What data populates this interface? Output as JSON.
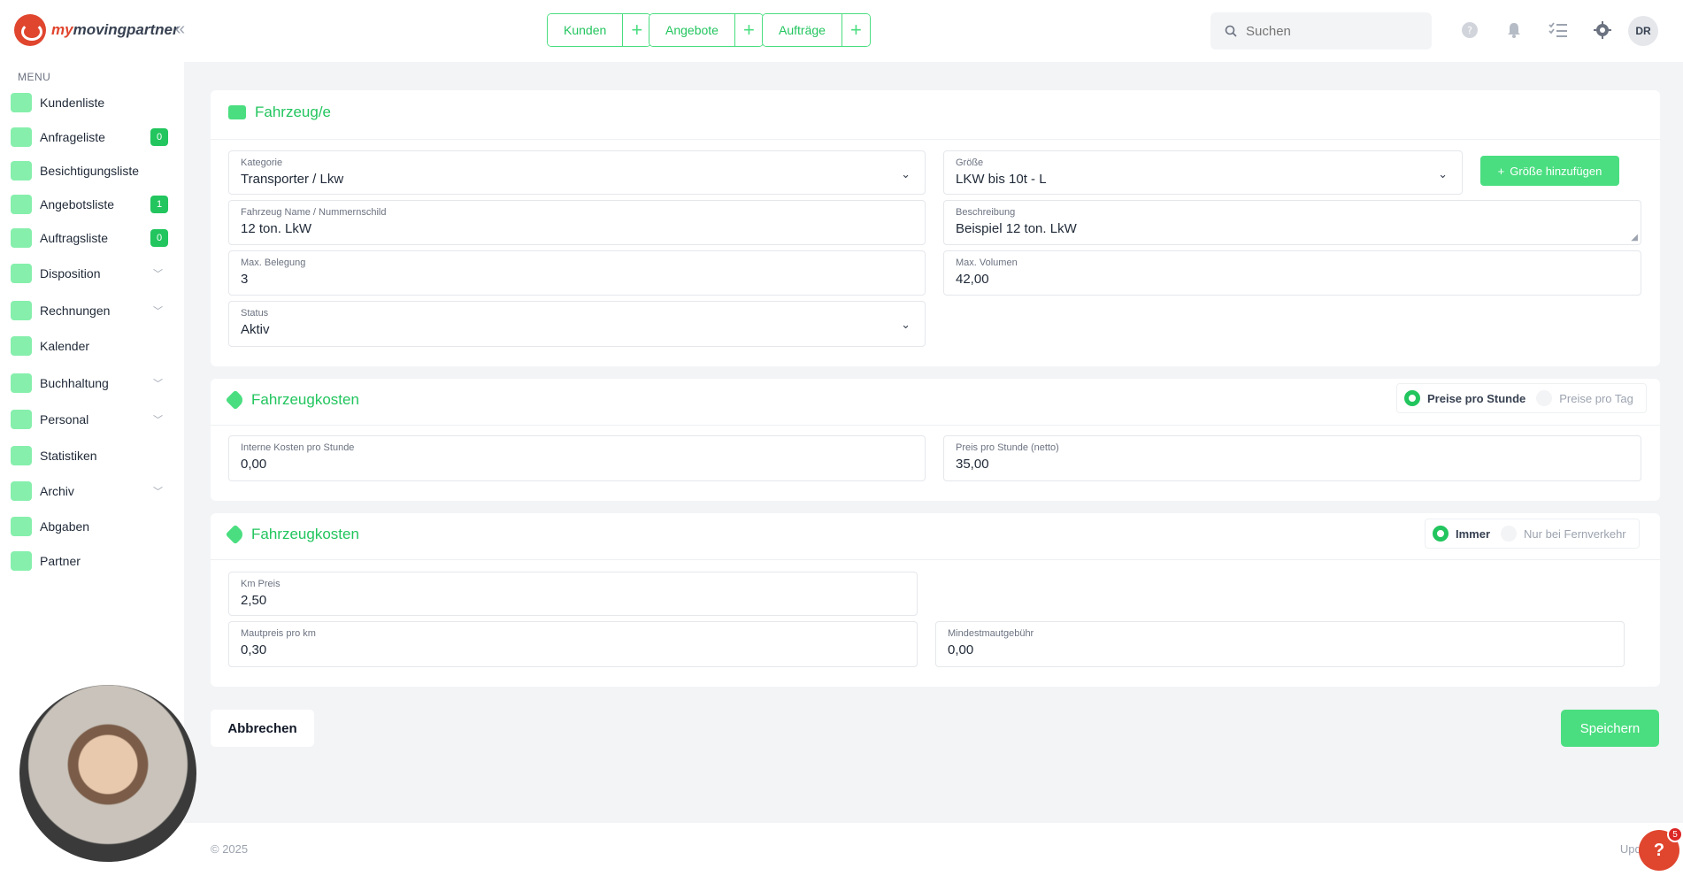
{
  "header": {
    "logo_prefix": "my",
    "logo_text": "movingpartner",
    "quick_buttons": [
      {
        "label": "Kunden"
      },
      {
        "label": "Angebote"
      },
      {
        "label": "Aufträge"
      }
    ],
    "search_placeholder": "Suchen",
    "avatar_initials": "DR"
  },
  "sidebar": {
    "menu_title": "MENU",
    "items": [
      {
        "label": "Kundenliste"
      },
      {
        "label": "Anfrageliste",
        "badge": "0"
      },
      {
        "label": "Besichtigungsliste"
      },
      {
        "label": "Angebotsliste",
        "badge": "1"
      },
      {
        "label": "Auftragsliste",
        "badge": "0"
      },
      {
        "label": "Disposition"
      },
      {
        "label": "Rechnungen"
      },
      {
        "label": "Kalender"
      },
      {
        "label": "Buchhaltung"
      },
      {
        "label": "Personal"
      },
      {
        "label": "Statistiken"
      },
      {
        "label": "Archiv"
      },
      {
        "label": "Abgaben"
      },
      {
        "label": "Partner"
      }
    ]
  },
  "vehicle": {
    "title": "Fahrzeug/e",
    "kategorie_label": "Kategorie",
    "kategorie_value": "Transporter / Lkw",
    "groesse_label": "Größe",
    "groesse_value": "LKW bis 10t - L",
    "add_size_label": "Größe hinzufügen",
    "name_label": "Fahrzeug Name / Nummernschild",
    "name_value": "12 ton. LkW",
    "beschreibung_label": "Beschreibung",
    "beschreibung_value": "Beispiel 12 ton. LkW",
    "belegung_label": "Max. Belegung",
    "belegung_value": "3",
    "volumen_label": "Max. Volumen",
    "volumen_value": "42,00",
    "status_label": "Status",
    "status_value": "Aktiv"
  },
  "costs_hourly": {
    "title": "Fahrzeugkosten",
    "toggle_on": "Preise pro Stunde",
    "toggle_off": "Preise pro Tag",
    "internal_label": "Interne Kosten pro Stunde",
    "internal_value": "0,00",
    "price_label": "Preis pro Stunde (netto)",
    "price_value": "35,00"
  },
  "costs_km": {
    "title": "Fahrzeugkosten",
    "toggle_on": "Immer",
    "toggle_off": "Nur bei Fernverkehr",
    "km_label": "Km Preis",
    "km_value": "2,50",
    "maut_label": "Mautpreis pro km",
    "maut_value": "0,30",
    "min_maut_label": "Mindestmautgebühr",
    "min_maut_value": "0,00"
  },
  "actions": {
    "cancel": "Abbrechen",
    "save": "Speichern"
  },
  "footer": {
    "copyright": "© 2025",
    "update": "Upda"
  },
  "help": {
    "icon": "?",
    "badge": "5"
  }
}
